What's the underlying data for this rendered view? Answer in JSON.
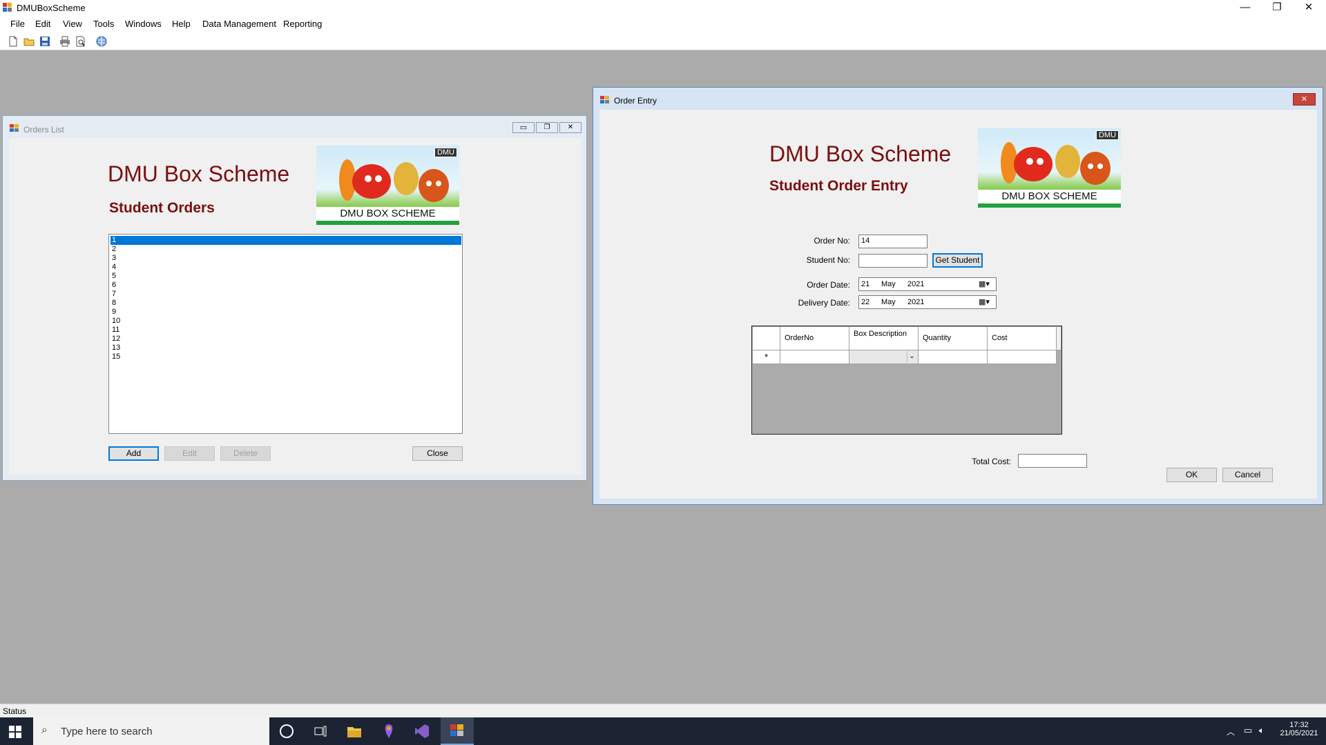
{
  "app": {
    "title": "DMUBoxScheme"
  },
  "window_controls": {
    "minimize": "—",
    "restore": "❐",
    "close": "✕"
  },
  "menu": [
    "File",
    "Edit",
    "View",
    "Tools",
    "Windows",
    "Help",
    "Data Management",
    "Reporting"
  ],
  "toolbar": {
    "icons": [
      "new-document-icon",
      "open-folder-icon",
      "save-icon",
      "print-icon",
      "print-preview-icon",
      "help-globe-icon"
    ]
  },
  "orders_window": {
    "title": "Orders List",
    "heading": "DMU Box Scheme",
    "subheading": "Student Orders",
    "logo_caption": "DMU BOX SCHEME",
    "logo_badge": "DMU",
    "list_items": [
      "1",
      "2",
      "3",
      "4",
      "5",
      "6",
      "7",
      "8",
      "9",
      "10",
      "11",
      "12",
      "13",
      "15"
    ],
    "selected_item": "1",
    "buttons": {
      "add": "Add",
      "edit": "Edit",
      "delete": "Delete",
      "close": "Close"
    }
  },
  "order_entry": {
    "title": "Order Entry",
    "heading": "DMU Box Scheme",
    "subheading": "Student Order Entry",
    "logo_caption": "DMU BOX SCHEME",
    "logo_badge": "DMU",
    "order_no_label": "Order No:",
    "order_no_value": "14",
    "student_no_label": "Student No:",
    "student_no_value": "",
    "get_student_button": "Get Student",
    "order_date_label": "Order Date:",
    "order_date": {
      "day": "21",
      "month": "May",
      "year": "2021"
    },
    "delivery_date_label": "Delivery Date:",
    "delivery_date": {
      "day": "22",
      "month": "May",
      "year": "2021"
    },
    "grid": {
      "columns": [
        "OrderNo",
        "Box Description",
        "Quantity",
        "Cost"
      ],
      "new_row_marker": "*"
    },
    "total_cost_label": "Total Cost:",
    "total_cost_value": "",
    "ok_button": "OK",
    "cancel_button": "Cancel"
  },
  "status_bar": {
    "text": "Status"
  },
  "taskbar": {
    "search_placeholder": "Type here to search",
    "time": "17:32",
    "date": "21/05/2021"
  }
}
